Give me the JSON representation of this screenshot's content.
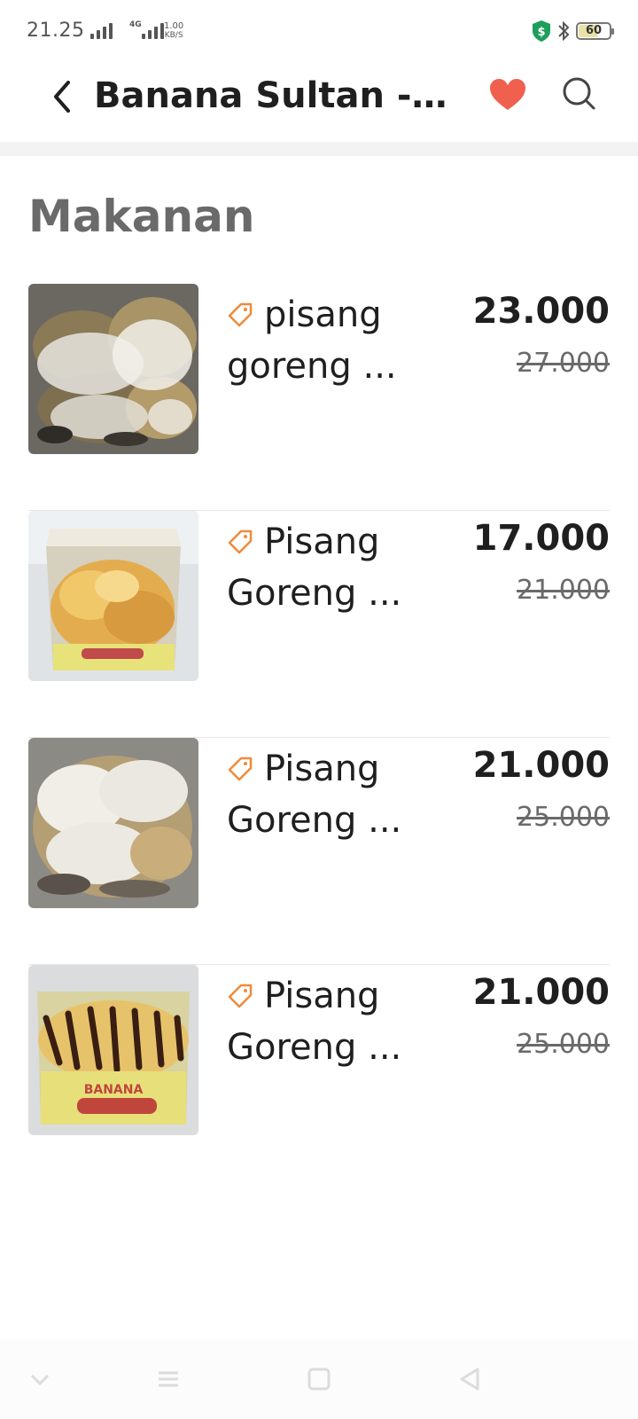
{
  "status_bar": {
    "time": "21.25",
    "network": "4G",
    "speed_value": "1.00",
    "speed_unit": "KB/S",
    "battery": "60",
    "icons": [
      "signal-icon",
      "signal-icon",
      "shield-icon",
      "bluetooth-icon",
      "battery-icon"
    ]
  },
  "header": {
    "title": "Banana Sultan - Ra...",
    "icons": [
      "back-arrow-icon",
      "heart-icon",
      "search-icon"
    ],
    "favorite_color": "#f0604f"
  },
  "section": {
    "title": "Makanan"
  },
  "items": [
    {
      "name": "pisang goreng ...",
      "price": "23.000",
      "old_price": "27.000",
      "icon": "tag-icon"
    },
    {
      "name": "Pisang Goreng ...",
      "price": "17.000",
      "old_price": "21.000",
      "icon": "tag-icon"
    },
    {
      "name": "Pisang Goreng ...",
      "price": "21.000",
      "old_price": "25.000",
      "icon": "tag-icon"
    },
    {
      "name": "Pisang Goreng ...",
      "price": "21.000",
      "old_price": "25.000",
      "icon": "tag-icon"
    }
  ],
  "colors": {
    "accent": "#f08a3a",
    "text": "#1f1f1f",
    "muted": "#6a6a6a"
  }
}
